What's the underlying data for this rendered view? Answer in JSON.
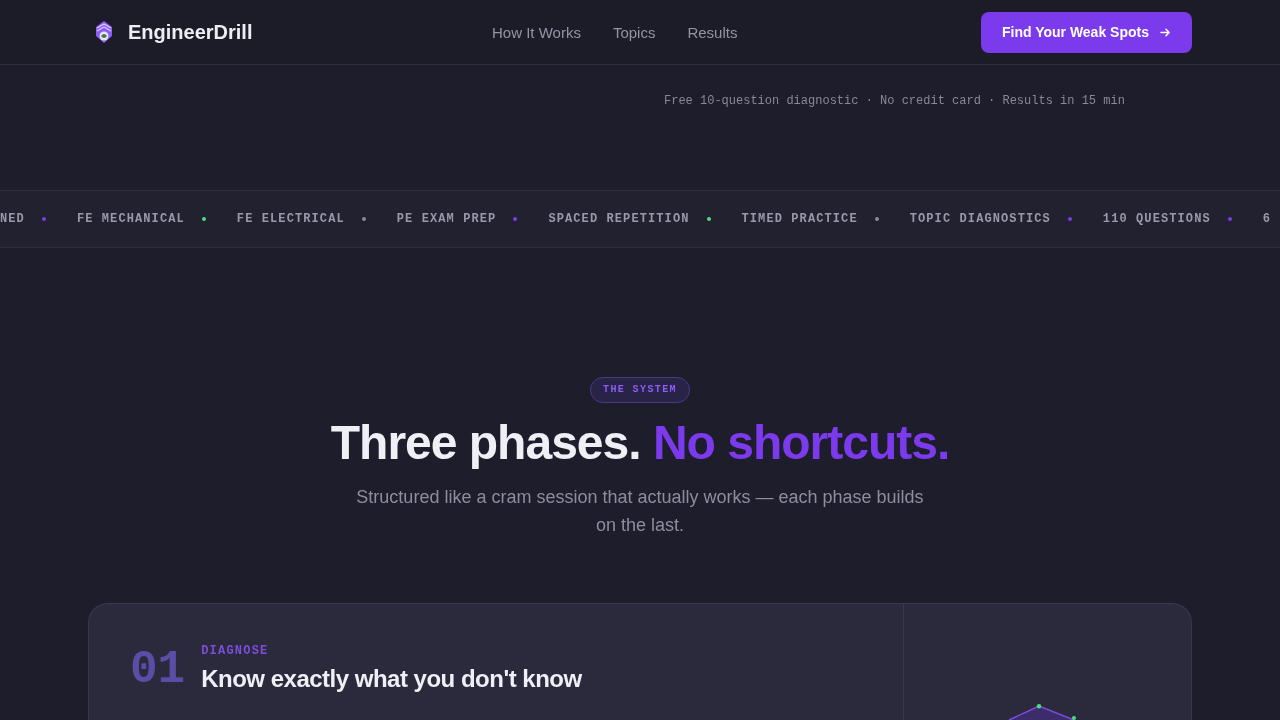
{
  "nav": {
    "brand": "EngineerDrill",
    "links": [
      {
        "label": "How It Works"
      },
      {
        "label": "Topics"
      },
      {
        "label": "Results"
      }
    ],
    "cta": "Find Your Weak Spots"
  },
  "hero": {
    "note": "Free 10-question diagnostic · No credit card · Results in 15 min"
  },
  "ticker": [
    {
      "label": "NED",
      "color": "#7c3aed"
    },
    {
      "label": "FE MECHANICAL",
      "color": "#4ade80"
    },
    {
      "label": "FE ELECTRICAL",
      "color": "#8a8898"
    },
    {
      "label": "PE EXAM PREP",
      "color": "#7c3aed"
    },
    {
      "label": "SPACED REPETITION",
      "color": "#4ade80"
    },
    {
      "label": "TIMED PRACTICE",
      "color": "#8a8898"
    },
    {
      "label": "TOPIC DIAGNOSTICS",
      "color": "#7c3aed"
    },
    {
      "label": "110 QUESTIONS",
      "color": "#7c3aed"
    },
    {
      "label": "6"
    }
  ],
  "system": {
    "badge": "THE SYSTEM",
    "heading": "Three phases.",
    "heading_accent": "No shortcuts.",
    "subtitle": "Structured like a cram session that actually works — each phase builds on the last."
  },
  "phases": [
    {
      "number": "01",
      "tag": "DIAGNOSE",
      "title": "Know exactly what you don't know"
    }
  ]
}
